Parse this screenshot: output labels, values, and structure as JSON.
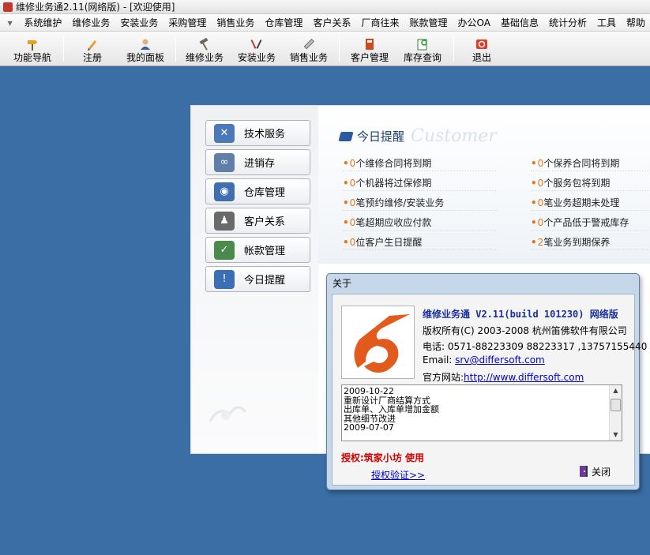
{
  "window": {
    "title": "维修业务通2.11(网络版) - [欢迎使用]"
  },
  "menu": {
    "items": [
      "系统维护",
      "维修业务",
      "安装业务",
      "采购管理",
      "销售业务",
      "仓库管理",
      "客户关系",
      "厂商往来",
      "账款管理",
      "办公OA",
      "基础信息",
      "统计分析",
      "工具",
      "帮助"
    ]
  },
  "toolbar": {
    "buttons": [
      {
        "label": "功能导航",
        "icon": "signpost-icon"
      },
      {
        "label": "注册",
        "icon": "pen-icon"
      },
      {
        "label": "我的面板",
        "icon": "user-icon"
      },
      {
        "label": "维修业务",
        "icon": "hammer-icon"
      },
      {
        "label": "安装业务",
        "icon": "tools-icon"
      },
      {
        "label": "销售业务",
        "icon": "ruler-icon"
      },
      {
        "label": "客户管理",
        "icon": "notebook-icon"
      },
      {
        "label": "库存查询",
        "icon": "search-doc-icon"
      },
      {
        "label": "退出",
        "icon": "exit-icon"
      }
    ]
  },
  "sidebar": {
    "buttons": [
      {
        "label": "技术服务",
        "icon": "wrench-screwdriver-icon",
        "color": "#4a78b8"
      },
      {
        "label": "进销存",
        "icon": "chain-icon",
        "color": "#5f7fa8"
      },
      {
        "label": "仓库管理",
        "icon": "barrel-icon",
        "color": "#3f6fb0"
      },
      {
        "label": "客户关系",
        "icon": "people-key-icon",
        "color": "#6a6a6a"
      },
      {
        "label": "帐款管理",
        "icon": "checklist-icon",
        "color": "#4a8a4a"
      },
      {
        "label": "今日提醒",
        "icon": "alert-icon",
        "color": "#3a6fb5"
      }
    ]
  },
  "reminders": {
    "title": "今日提醒",
    "watermark": "Customer",
    "left": [
      {
        "count": "0",
        "text": "个维修合同将到期"
      },
      {
        "count": "0",
        "text": "个机器将过保修期"
      },
      {
        "count": "0",
        "text": "笔预约维修/安装业务"
      },
      {
        "count": "0",
        "text": "笔超期应收应付款"
      },
      {
        "count": "0",
        "text": "位客户生日提醒"
      }
    ],
    "right": [
      {
        "count": "0",
        "text": "个保养合同将到期"
      },
      {
        "count": "0",
        "text": "个服务包将到期"
      },
      {
        "count": "0",
        "text": "笔业务超期未处理"
      },
      {
        "count": "0",
        "text": "个产品低于警戒库存"
      },
      {
        "count": "2",
        "text": "笔业务到期保养"
      }
    ]
  },
  "about": {
    "title": "关于",
    "product": "维修业务通 V2.11(build 101230) 网络版",
    "copyright": "版权所有(C) 2003-2008 杭州笛佛软件有限公司",
    "phone_label": "电话:",
    "phone": "0571-88223309 88223317 ,13757155440",
    "email_label": "Email:",
    "email": "srv@differsoft.com",
    "website_label": "官方网站:",
    "website": "http://www.differsoft.com",
    "changelog": [
      "2009-10-22",
      "重新设计厂商结算方式",
      "出库单、入库单增加金额",
      "其他细节改进",
      "2009-07-07"
    ],
    "license": "授权:筑家小坊 使用",
    "verify_link": "授权验证>>",
    "close_label": "关闭",
    "brand_color": "#e25b1c"
  }
}
